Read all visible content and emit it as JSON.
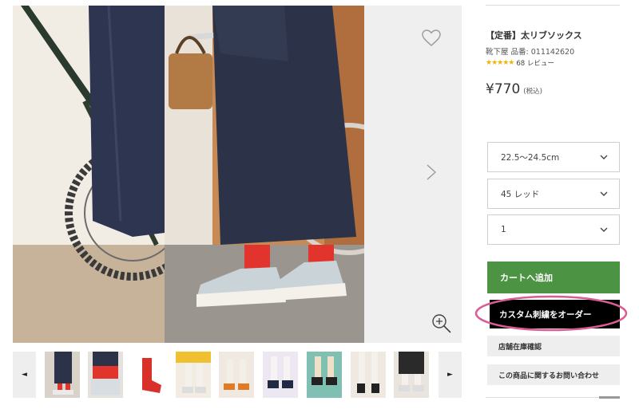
{
  "product": {
    "title": "【定番】太リブソックス",
    "brand": "靴下屋",
    "code": "品番: 011142620",
    "rating_stars": "★★★★★",
    "review_count": "68 レビュー",
    "price": "¥770",
    "tax_note": "(税込)"
  },
  "options": {
    "size": "22.5〜24.5cm",
    "color": "45 レッド",
    "quantity": "1"
  },
  "actions": {
    "add_to_cart": "カートへ追加",
    "custom_embroidery": "カスタム刺繍をオーダー",
    "store_stock": "店舗在庫確認",
    "inquiry": "この商品に関するお問い合わせ"
  },
  "gallery": {
    "prev_arrow": "◄",
    "next_arrow": "►",
    "thumbnail_count": 9
  },
  "icons": {
    "favorite": "heart-outline-icon",
    "next": "chevron-right-icon",
    "zoom": "zoom-in-icon"
  },
  "colors": {
    "cart_green": "#4d9344",
    "custom_black": "#000000",
    "highlight_pink": "#d95c95",
    "star_gold": "#f1b400"
  }
}
